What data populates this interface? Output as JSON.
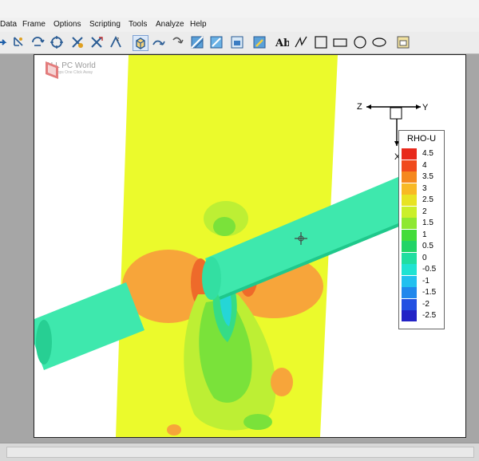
{
  "menu": [
    "Data",
    "Frame",
    "Options",
    "Scripting",
    "Tools",
    "Analyze",
    "Help"
  ],
  "toolbar_icons": [
    "arrow-right-icon",
    "probe-icon",
    "rotate-icon",
    "translate-icon",
    "zoom-icon",
    "zoom-box-icon",
    "3d-rotate-icon",
    "view-cube-icon",
    "stream-icon",
    "curve-arrow-icon",
    "contour-icon",
    "slice-icon",
    "iso-surface-icon",
    "edit-icon",
    "text-icon",
    "line-icon",
    "square-icon",
    "rectangle-icon",
    "circle-icon",
    "ellipse-icon",
    "frame-icon"
  ],
  "watermark": {
    "title": "ALL PC World",
    "subtitle": "Free Apps One Click Away"
  },
  "axis": {
    "z": "Z",
    "y": "Y",
    "x": "X"
  },
  "legend": {
    "title": "RHO-U",
    "levels": [
      {
        "label": "4.5",
        "color": "#e8291c"
      },
      {
        "label": "4",
        "color": "#f04a1c"
      },
      {
        "label": "3.5",
        "color": "#f5881e"
      },
      {
        "label": "3",
        "color": "#f8b925"
      },
      {
        "label": "2.5",
        "color": "#e8e324"
      },
      {
        "label": "2",
        "color": "#cbef2a"
      },
      {
        "label": "1.5",
        "color": "#8ee832"
      },
      {
        "label": "1",
        "color": "#43dc3a"
      },
      {
        "label": "0.5",
        "color": "#21d466"
      },
      {
        "label": "0",
        "color": "#20dea0"
      },
      {
        "label": "-0.5",
        "color": "#1fe3d2"
      },
      {
        "label": "-1",
        "color": "#22c0ef"
      },
      {
        "label": "-1.5",
        "color": "#2188ec"
      },
      {
        "label": "-2",
        "color": "#2350e2"
      },
      {
        "label": "-2.5",
        "color": "#2323c6"
      }
    ]
  },
  "colors": {
    "field": "#ebfa2c",
    "cylinder": "#3ee8ad",
    "cylinder_dark": "#1fc88b"
  }
}
